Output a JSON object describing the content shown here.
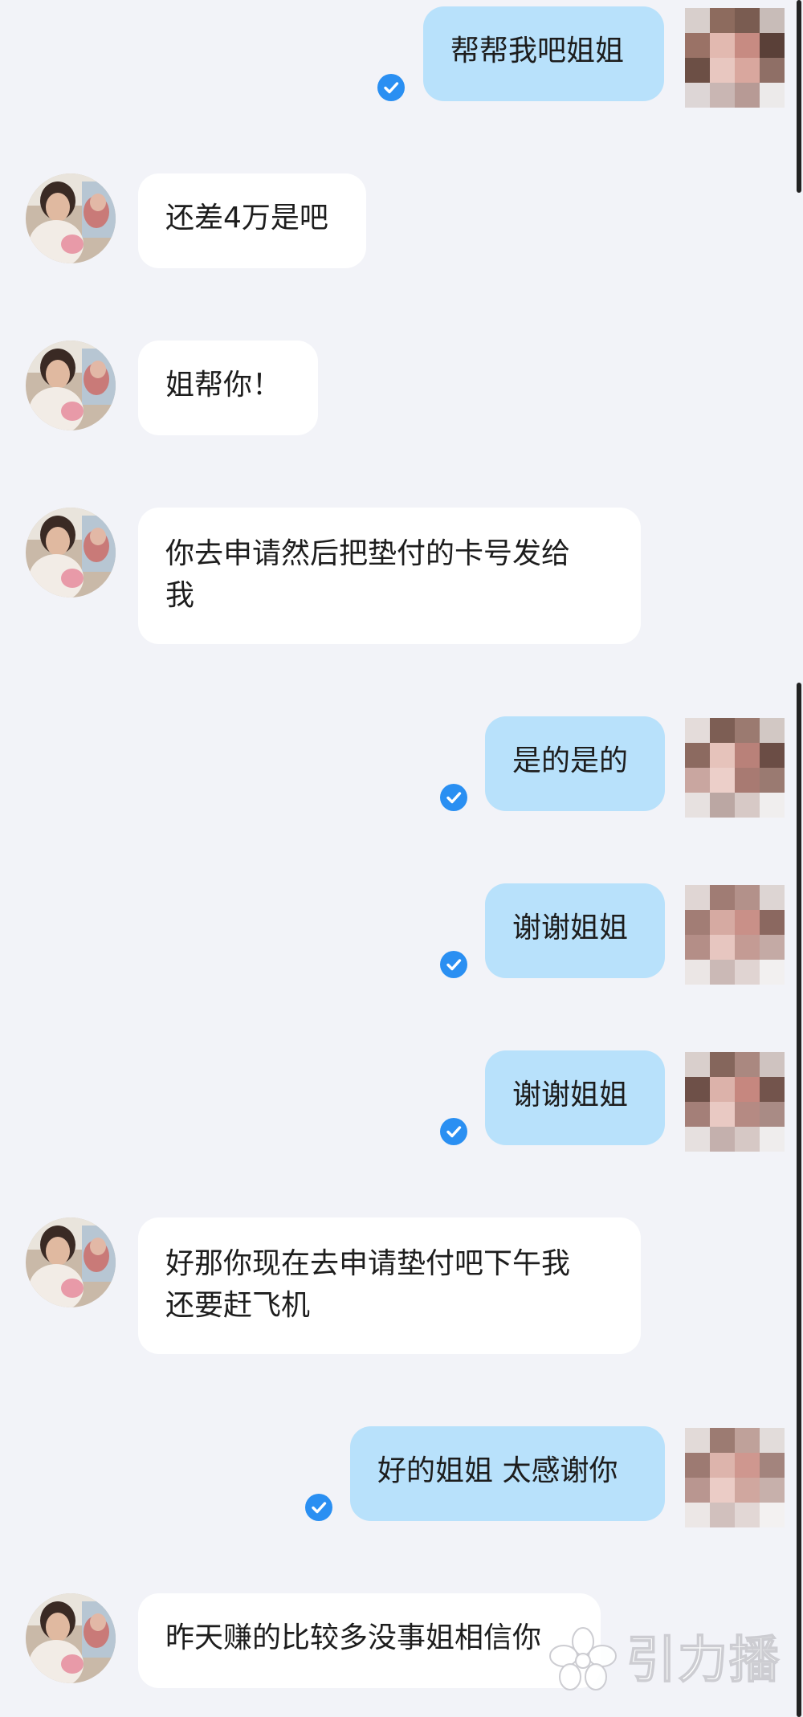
{
  "messages": [
    {
      "side": "out",
      "text": "帮帮我吧姐姐",
      "read": true
    },
    {
      "side": "in",
      "text": "还差4万是吧"
    },
    {
      "side": "in",
      "text": "姐帮你！"
    },
    {
      "side": "in",
      "text": "你去申请然后把垫付的卡号发给\n我"
    },
    {
      "side": "out",
      "text": "是的是的",
      "read": true
    },
    {
      "side": "out",
      "text": "谢谢姐姐",
      "read": true
    },
    {
      "side": "out",
      "text": "谢谢姐姐",
      "read": true
    },
    {
      "side": "in",
      "text": "好那你现在去申请垫付吧下午我\n还要赶飞机"
    },
    {
      "side": "out",
      "text": "好的姐姐 太感谢你",
      "read": true
    },
    {
      "side": "in",
      "text": "昨天赚的比较多没事姐相信你"
    }
  ],
  "watermark": {
    "text": "引力播"
  },
  "colors": {
    "background": "#f2f3f8",
    "outgoing_bubble": "#b8e1fb",
    "incoming_bubble": "#ffffff",
    "read_check": "#2a8ff2"
  },
  "icons": {
    "read_receipt": "check-circle-icon",
    "watermark_logo": "flower-logo-icon"
  }
}
